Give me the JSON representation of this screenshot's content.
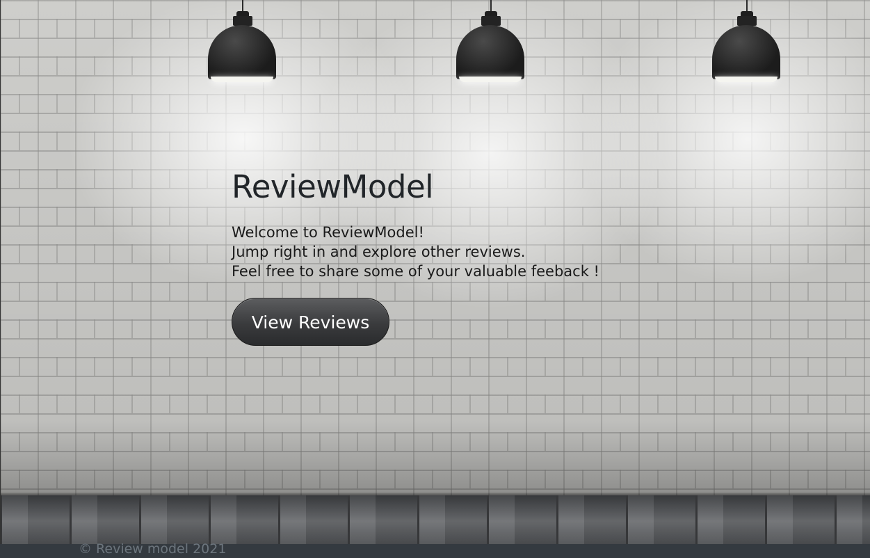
{
  "hero": {
    "title": "ReviewModel",
    "line1": "Welcome to ReviewModel!",
    "line2": "Jump right in and explore other reviews.",
    "line3": "Feel free to share some of your valuable feeback !",
    "cta_label": "View Reviews"
  },
  "footer": {
    "copyright": "© Review model 2021"
  },
  "colors": {
    "title": "#212529",
    "button_bg": "#3a3b3d",
    "footer_bg": "#343a40",
    "footer_text": "#6c757d"
  }
}
